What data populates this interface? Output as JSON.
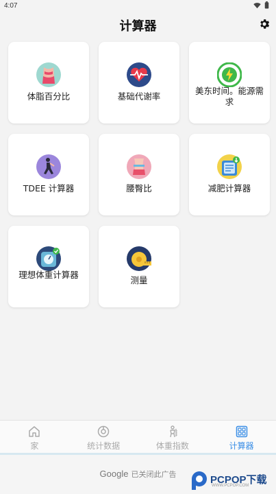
{
  "status_bar": {
    "time": "4:07"
  },
  "header": {
    "title": "计算器"
  },
  "cards": [
    {
      "label": "体脂百分比",
      "icon": "torso-icon"
    },
    {
      "label": "基础代谢率",
      "icon": "heart-rate-icon"
    },
    {
      "label": "美东时间。能源需求",
      "icon": "energy-icon"
    },
    {
      "label": "TDEE 计算器",
      "icon": "exercise-icon"
    },
    {
      "label": "腰臀比",
      "icon": "waist-hip-icon"
    },
    {
      "label": "减肥计算器",
      "icon": "scale-icon"
    },
    {
      "label": "理想体重计算器",
      "icon": "ideal-scale-icon"
    },
    {
      "label": "测量",
      "icon": "tape-measure-icon"
    }
  ],
  "bottom_nav": {
    "items": [
      {
        "label": "家",
        "icon": "home-icon"
      },
      {
        "label": "统计数据",
        "icon": "stats-icon"
      },
      {
        "label": "体重指数",
        "icon": "bmi-icon"
      },
      {
        "label": "计算器",
        "icon": "calculator-icon"
      }
    ],
    "active": "计算器"
  },
  "ad": {
    "brand": "Google",
    "text": "已关闭此广告"
  },
  "watermark": {
    "text": "PCPOP下载",
    "sub": "WWW.PCPOP.COM"
  },
  "colors": {
    "accent": "#3a8ee6",
    "background": "#f3f3f3",
    "card": "#ffffff"
  }
}
